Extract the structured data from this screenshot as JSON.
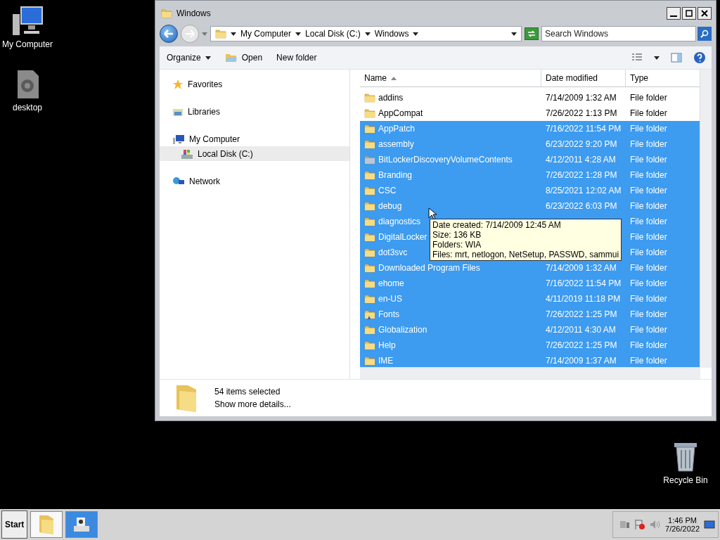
{
  "desktop_icons": [
    {
      "label": "My Computer",
      "kind": "computer"
    },
    {
      "label": "desktop",
      "kind": "gear"
    }
  ],
  "recycle_bin": {
    "label": "Recycle Bin"
  },
  "window": {
    "title": "Windows"
  },
  "address": {
    "crumbs": [
      "My Computer",
      "Local Disk (C:)",
      "Windows"
    ]
  },
  "search": {
    "placeholder": "Search Windows"
  },
  "toolbar": [
    {
      "label": "Organize",
      "kind": "menu"
    },
    {
      "label": "Open",
      "kind": "open"
    },
    {
      "label": "New folder",
      "kind": "plain"
    }
  ],
  "nav": [
    {
      "label": "Favorites",
      "kind": "star",
      "selected": false
    },
    {
      "label": "Libraries",
      "kind": "library",
      "selected": false
    },
    {
      "label": "My Computer",
      "kind": "computer",
      "selected": false,
      "children": [
        {
          "label": "Local Disk (C:)",
          "kind": "disk",
          "selected": true
        }
      ]
    },
    {
      "label": "Network",
      "kind": "network",
      "selected": false
    }
  ],
  "columns": [
    {
      "label": "Name",
      "sorted": true
    },
    {
      "label": "Date modified",
      "sorted": false
    },
    {
      "label": "Type",
      "sorted": false
    }
  ],
  "rows": [
    {
      "name": "addins",
      "date": "7/14/2009 1:32 AM",
      "type": "File folder",
      "kind": "folder",
      "selected": false
    },
    {
      "name": "AppCompat",
      "date": "7/26/2022 1:13 PM",
      "type": "File folder",
      "kind": "folder",
      "selected": false
    },
    {
      "name": "AppPatch",
      "date": "7/16/2022 11:54 PM",
      "type": "File folder",
      "kind": "folder",
      "selected": true
    },
    {
      "name": "assembly",
      "date": "6/23/2022 9:20 PM",
      "type": "File folder",
      "kind": "folder",
      "selected": true
    },
    {
      "name": "BitLockerDiscoveryVolumeContents",
      "date": "4/12/2011 4:28 AM",
      "type": "File folder",
      "kind": "system",
      "selected": true
    },
    {
      "name": "Branding",
      "date": "7/26/2022 1:28 PM",
      "type": "File folder",
      "kind": "folder",
      "selected": true
    },
    {
      "name": "CSC",
      "date": "8/25/2021 12:02 AM",
      "type": "File folder",
      "kind": "folder",
      "selected": true
    },
    {
      "name": "debug",
      "date": "6/23/2022 6:03 PM",
      "type": "File folder",
      "kind": "folder",
      "selected": true
    },
    {
      "name": "diagnostics",
      "type": "File folder",
      "kind": "folder",
      "selected": true
    },
    {
      "name": "DigitalLocker",
      "type": "File folder",
      "kind": "folder",
      "selected": true
    },
    {
      "name": "dot3svc",
      "type": "File folder",
      "kind": "folder",
      "selected": true
    },
    {
      "name": "Downloaded Program Files",
      "date": "7/14/2009 1:32 AM",
      "type": "File folder",
      "kind": "folder",
      "selected": true
    },
    {
      "name": "ehome",
      "date": "7/16/2022 11:54 PM",
      "type": "File folder",
      "kind": "folder",
      "selected": true
    },
    {
      "name": "en-US",
      "date": "4/11/2019 11:18 PM",
      "type": "File folder",
      "kind": "folder",
      "selected": true
    },
    {
      "name": "Fonts",
      "date": "7/26/2022 1:25 PM",
      "type": "File folder",
      "kind": "fonts",
      "selected": true
    },
    {
      "name": "Globalization",
      "date": "4/12/2011 4:30 AM",
      "type": "File folder",
      "kind": "folder",
      "selected": true
    },
    {
      "name": "Help",
      "date": "7/26/2022 1:25 PM",
      "type": "File folder",
      "kind": "folder",
      "selected": true
    },
    {
      "name": "IME",
      "date": "7/14/2009 1:37 AM",
      "type": "File folder",
      "kind": "folder",
      "selected": true
    }
  ],
  "tooltip": {
    "lines": [
      "Date created: 7/14/2009 12:45 AM",
      "Size: 136 KB",
      "Folders: WIA",
      "Files: mrt, netlogon, NetSetup, PASSWD, sammui"
    ]
  },
  "details": {
    "count": "54 items selected",
    "link": "Show more details..."
  },
  "taskbar": {
    "start": "Start",
    "apps": [
      {
        "kind": "explorer"
      },
      {
        "kind": "scanner"
      }
    ],
    "time": "1:46 PM",
    "date": "7/26/2022"
  }
}
